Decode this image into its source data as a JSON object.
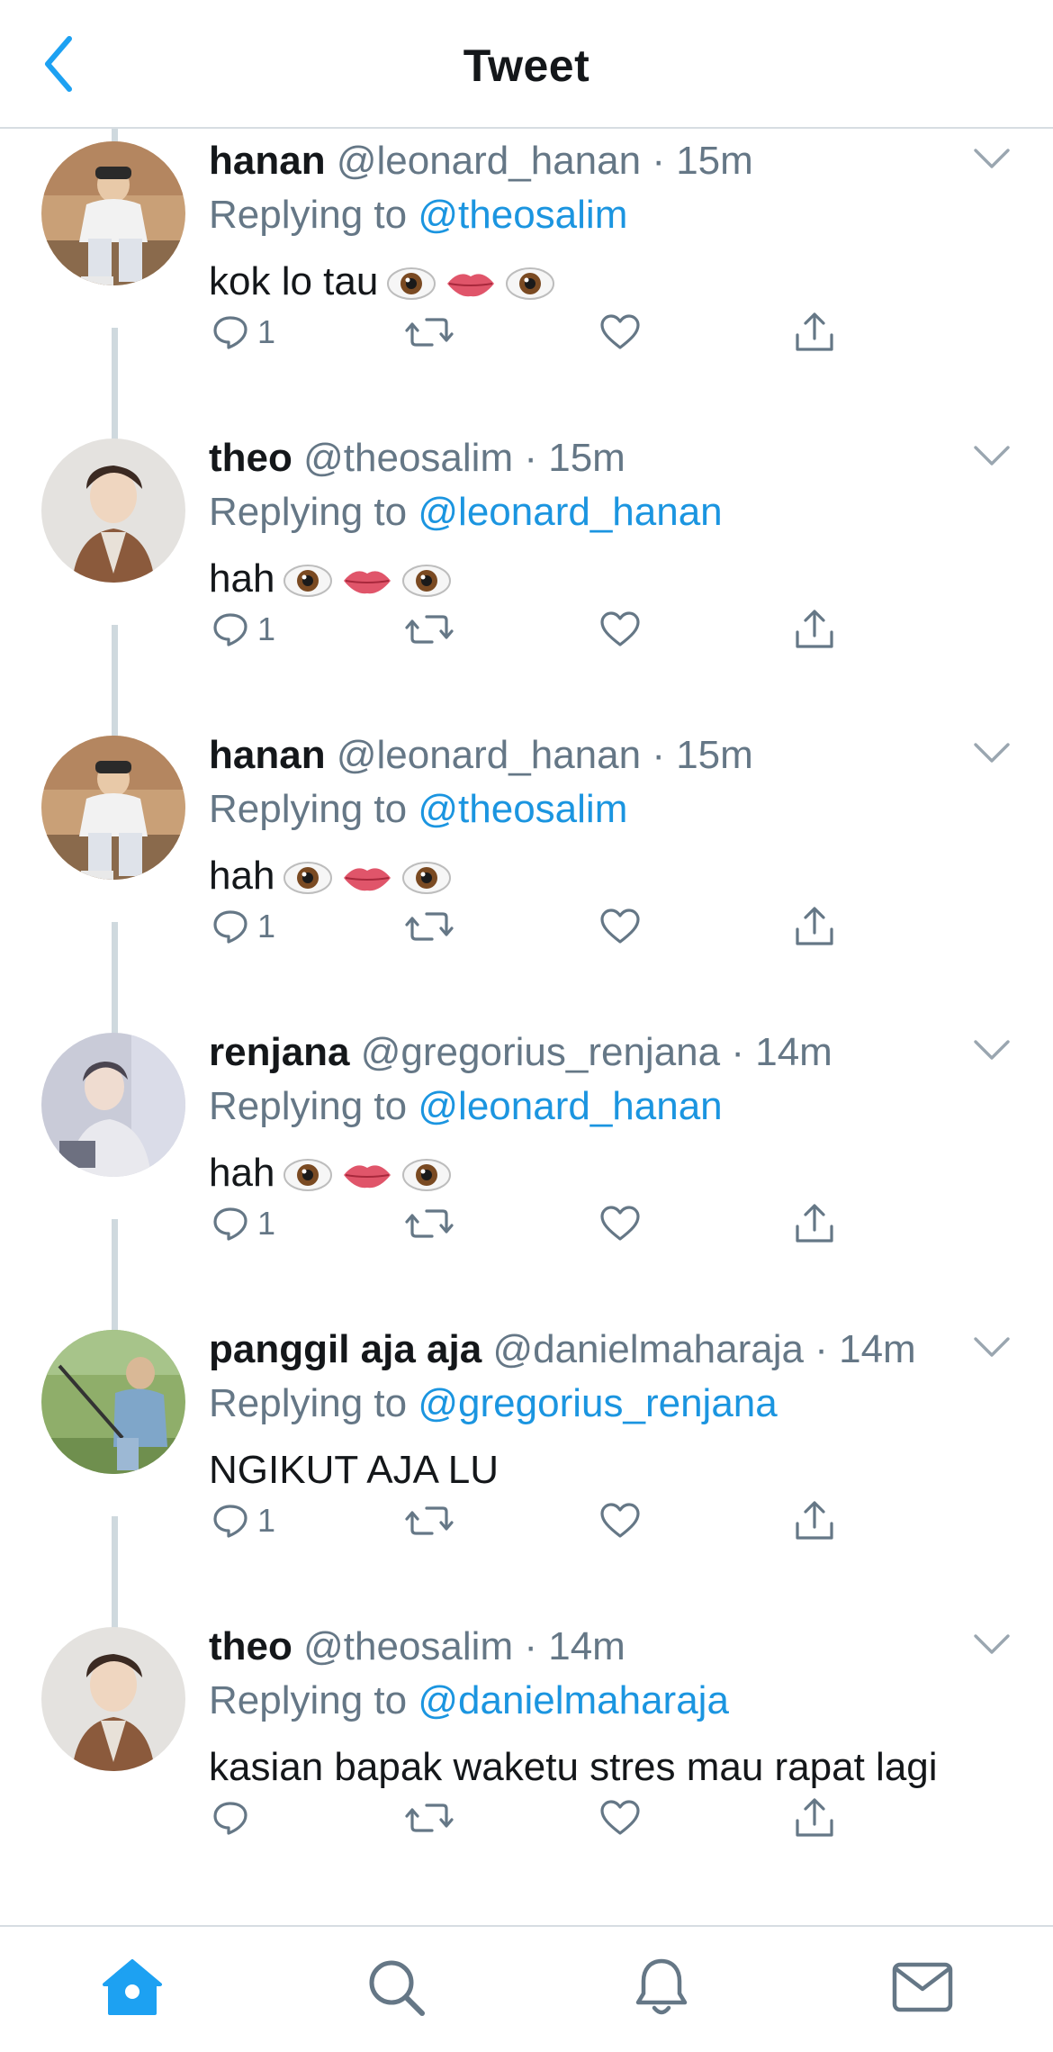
{
  "header": {
    "title": "Tweet"
  },
  "colors": {
    "accent": "#1b95e0",
    "muted": "#657786",
    "thread_line": "#cfd9de"
  },
  "tweets": [
    {
      "name": "hanan",
      "handle": "@leonard_hanan",
      "time": "15m",
      "replying_label": "Replying to",
      "reply_to": "@theosalim",
      "text": "kok lo tau",
      "emojis": [
        "eye",
        "lips",
        "eye"
      ],
      "reply_count": "1",
      "avatar": "hanan-avatar"
    },
    {
      "name": "theo",
      "handle": "@theosalim",
      "time": "15m",
      "replying_label": "Replying to",
      "reply_to": "@leonard_hanan",
      "text": "hah",
      "emojis": [
        "eye",
        "lips",
        "eye"
      ],
      "reply_count": "1",
      "avatar": "theo-avatar"
    },
    {
      "name": "hanan",
      "handle": "@leonard_hanan",
      "time": "15m",
      "replying_label": "Replying to",
      "reply_to": "@theosalim",
      "text": "hah",
      "emojis": [
        "eye",
        "lips",
        "eye"
      ],
      "reply_count": "1",
      "avatar": "hanan-avatar"
    },
    {
      "name": "renjana",
      "handle": "@gregorius_renjana",
      "time": "14m",
      "replying_label": "Replying to",
      "reply_to": "@leonard_hanan",
      "text": "hah",
      "emojis": [
        "eye",
        "lips",
        "eye"
      ],
      "reply_count": "1",
      "avatar": "renjana-avatar"
    },
    {
      "name": "panggil aja aja",
      "handle": "@danielmaharaja",
      "time": "14m",
      "replying_label": "Replying to",
      "reply_to": "@gregorius_renjana",
      "text": "NGIKUT AJA LU",
      "emojis": [],
      "reply_count": "1",
      "avatar": "daniel-avatar"
    },
    {
      "name": "theo",
      "handle": "@theosalim",
      "time": "14m",
      "replying_label": "Replying to",
      "reply_to": "@danielmaharaja",
      "text": "kasian bapak waketu stres mau rapat lagi",
      "emojis": [],
      "reply_count": "",
      "avatar": "theo-avatar"
    }
  ],
  "tabs": [
    "home-icon",
    "search-icon",
    "notifications-icon",
    "messages-icon"
  ]
}
